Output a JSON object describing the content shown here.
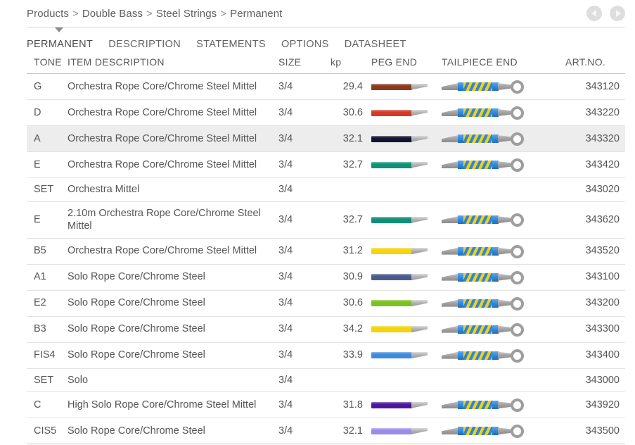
{
  "breadcrumb": {
    "separator": ">",
    "items": [
      "Products",
      "Double Bass",
      "Steel Strings",
      "Permanent"
    ]
  },
  "nav": {
    "prev_label": "prev-page",
    "next_label": "next-page"
  },
  "tabs": [
    {
      "label": "PERMANENT",
      "active": true
    },
    {
      "label": "DESCRIPTION",
      "active": false
    },
    {
      "label": "STATEMENTS",
      "active": false
    },
    {
      "label": "OPTIONS",
      "active": false
    },
    {
      "label": "DATASHEET",
      "active": false
    }
  ],
  "table": {
    "headers": {
      "tone": "TONE",
      "description": "ITEM DESCRIPTION",
      "size": "SIZE",
      "kp": "kp",
      "peg_end": "PEG END",
      "tailpiece_end": "TAILPIECE END",
      "art_no": "ART.NO."
    },
    "rows": [
      {
        "tone": "G",
        "description": "Orchestra Rope Core/Chrome Steel Mittel",
        "size": "3/4",
        "kp": "29.4",
        "peg_color": "#8B3A1E",
        "has_ends": true,
        "art_no": "343120",
        "highlight": false
      },
      {
        "tone": "D",
        "description": "Orchestra Rope Core/Chrome Steel Mittel",
        "size": "3/4",
        "kp": "30.6",
        "peg_color": "#D43A2A",
        "has_ends": true,
        "art_no": "343220",
        "highlight": false
      },
      {
        "tone": "A",
        "description": "Orchestra Rope Core/Chrome Steel Mittel",
        "size": "3/4",
        "kp": "32.1",
        "peg_color": "#141432",
        "has_ends": true,
        "art_no": "343320",
        "highlight": true
      },
      {
        "tone": "E",
        "description": "Orchestra Rope Core/Chrome Steel Mittel",
        "size": "3/4",
        "kp": "32.7",
        "peg_color": "#0E9176",
        "has_ends": true,
        "art_no": "343420",
        "highlight": false
      },
      {
        "tone": "SET",
        "description": "Orchestra Mittel",
        "size": "3/4",
        "kp": "",
        "peg_color": "",
        "has_ends": false,
        "art_no": "343020",
        "highlight": false
      },
      {
        "tone": "E",
        "description": "2.10m Orchestra Rope Core/Chrome Steel Mittel",
        "size": "3/4",
        "kp": "32.7",
        "peg_color": "#0E9176",
        "has_ends": true,
        "art_no": "343620",
        "highlight": false
      },
      {
        "tone": "B5",
        "description": "Orchestra Rope Core/Chrome Steel Mittel",
        "size": "3/4",
        "kp": "31.2",
        "peg_color": "#F5D310",
        "has_ends": true,
        "art_no": "343520",
        "highlight": false
      },
      {
        "tone": "A1",
        "description": "Solo Rope Core/Chrome Steel",
        "size": "3/4",
        "kp": "30.9",
        "peg_color": "#4A5B8C",
        "has_ends": true,
        "art_no": "343100",
        "highlight": false
      },
      {
        "tone": "E2",
        "description": "Solo Rope Core/Chrome Steel",
        "size": "3/4",
        "kp": "30.6",
        "peg_color": "#7DC023",
        "has_ends": true,
        "art_no": "343200",
        "highlight": false
      },
      {
        "tone": "B3",
        "description": "Solo Rope Core/Chrome Steel",
        "size": "3/4",
        "kp": "34.2",
        "peg_color": "#F5D310",
        "has_ends": true,
        "art_no": "343300",
        "highlight": false
      },
      {
        "tone": "FIS4",
        "description": "Solo Rope Core/Chrome Steel",
        "size": "3/4",
        "kp": "33.9",
        "peg_color": "#3D8BDB",
        "has_ends": true,
        "art_no": "343400",
        "highlight": false
      },
      {
        "tone": "SET",
        "description": "Solo",
        "size": "3/4",
        "kp": "",
        "peg_color": "",
        "has_ends": false,
        "art_no": "343000",
        "highlight": false
      },
      {
        "tone": "C",
        "description": "High Solo Rope Core/Chrome Steel Mittel",
        "size": "3/4",
        "kp": "31.8",
        "peg_color": "#4B189B",
        "has_ends": true,
        "art_no": "343920",
        "highlight": false
      },
      {
        "tone": "CIS5",
        "description": "Solo Rope Core/Chrome Steel",
        "size": "3/4",
        "kp": "32.1",
        "peg_color": "#9B8BEA",
        "has_ends": true,
        "art_no": "343500",
        "highlight": false
      }
    ]
  }
}
